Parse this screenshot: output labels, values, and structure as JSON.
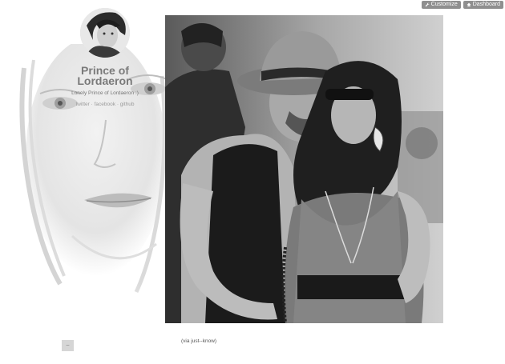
{
  "controls": {
    "customize_label": "Customize",
    "dashboard_label": "Dashboard",
    "customize_icon": "wrench-icon",
    "dashboard_icon": "home-icon"
  },
  "blog": {
    "title_line1": "Prince of",
    "title_line2": "Lordaeron",
    "description": "Lonely Prince of Lordaeron :)",
    "social": {
      "twitter": "twitter",
      "facebook": "facebook",
      "github": "github",
      "separator": "·"
    }
  },
  "post": {
    "caption_prefix": "(via ",
    "caption_source": "just--know",
    "caption_suffix": ")"
  },
  "scroll_top_label": "–"
}
